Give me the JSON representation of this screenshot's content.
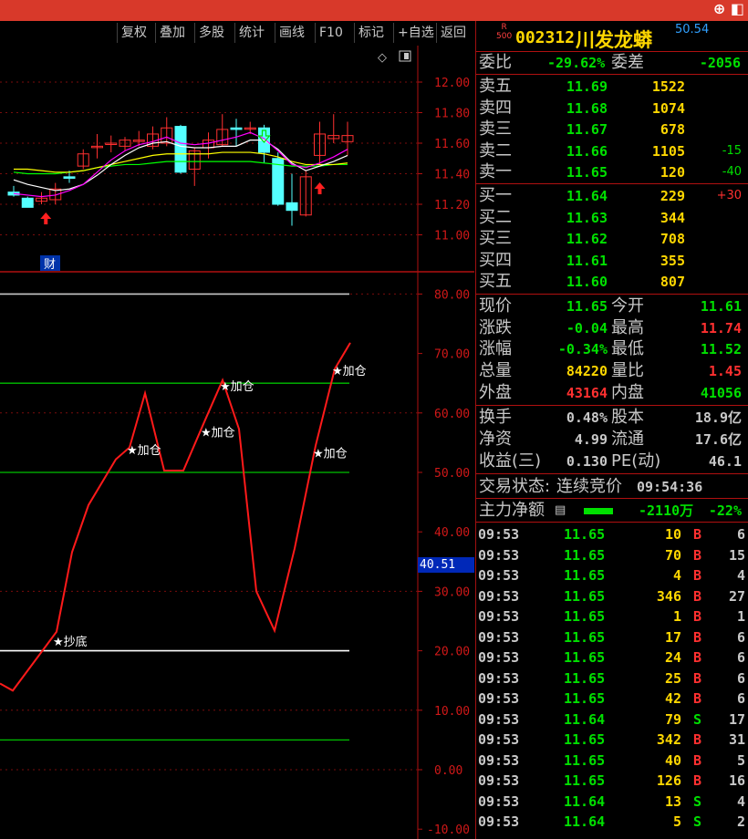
{
  "toolbar": {
    "buttons": [
      "复权",
      "叠加",
      "多股",
      "统计",
      "画线",
      "F10",
      "标记",
      "+自选",
      "返回"
    ]
  },
  "header": {
    "badge_r": "R",
    "badge_num": "500",
    "code": "002312",
    "name": "川发龙蟒",
    "corner_value": "50.54"
  },
  "kline": {
    "y_labels": [
      "12.00",
      "11.80",
      "11.60",
      "11.40",
      "11.20",
      "11.00"
    ],
    "cai_label": "财",
    "colors": {
      "up": "#ff3030",
      "down": "#54ffff",
      "ma5": "#ffffff",
      "ma10": "#ffff00",
      "ma20": "#ff00ff",
      "ma60": "#00ff00"
    }
  },
  "indicator": {
    "y_labels": [
      "80.00",
      "70.00",
      "60.00",
      "50.00",
      "40.00",
      "30.00",
      "20.00",
      "10.00",
      "0.00",
      "-10.00"
    ],
    "price_marker": "40.51",
    "signals": [
      "★抄底",
      "★加仓",
      "★加仓",
      "★加仓",
      "★加仓",
      "★加仓"
    ]
  },
  "order_book": {
    "weibi_label": "委比",
    "weibi": "-29.62%",
    "weicha_label": "委差",
    "weicha": "-2056",
    "asks": [
      {
        "label": "卖五",
        "price": "11.69",
        "vol": "1522",
        "chg": ""
      },
      {
        "label": "卖四",
        "price": "11.68",
        "vol": "1074",
        "chg": ""
      },
      {
        "label": "卖三",
        "price": "11.67",
        "vol": "678",
        "chg": ""
      },
      {
        "label": "卖二",
        "price": "11.66",
        "vol": "1105",
        "chg": "-15"
      },
      {
        "label": "卖一",
        "price": "11.65",
        "vol": "120",
        "chg": "-40"
      }
    ],
    "bids": [
      {
        "label": "买一",
        "price": "11.64",
        "vol": "229",
        "chg": "+30"
      },
      {
        "label": "买二",
        "price": "11.63",
        "vol": "344",
        "chg": ""
      },
      {
        "label": "买三",
        "price": "11.62",
        "vol": "708",
        "chg": ""
      },
      {
        "label": "买四",
        "price": "11.61",
        "vol": "355",
        "chg": ""
      },
      {
        "label": "买五",
        "price": "11.60",
        "vol": "807",
        "chg": ""
      }
    ]
  },
  "quote": [
    {
      "l1": "现价",
      "v1": "11.65",
      "c1": "#00e000",
      "l2": "今开",
      "v2": "11.61",
      "c2": "#00e000"
    },
    {
      "l1": "涨跌",
      "v1": "-0.04",
      "c1": "#00e000",
      "l2": "最高",
      "v2": "11.74",
      "c2": "#ff3030"
    },
    {
      "l1": "涨幅",
      "v1": "-0.34%",
      "c1": "#00e000",
      "l2": "最低",
      "v2": "11.52",
      "c2": "#00e000"
    },
    {
      "l1": "总量",
      "v1": "84220",
      "c1": "#ffd700",
      "l2": "量比",
      "v2": "1.45",
      "c2": "#ff3030"
    },
    {
      "l1": "外盘",
      "v1": "43164",
      "c1": "#ff3030",
      "l2": "内盘",
      "v2": "41056",
      "c2": "#00e000"
    }
  ],
  "fundamentals": [
    {
      "l1": "换手",
      "v1": "0.48%",
      "l2": "股本",
      "v2": "18.9亿"
    },
    {
      "l1": "净资",
      "v1": "4.99",
      "l2": "流通",
      "v2": "17.6亿"
    },
    {
      "l1": "收益(三)",
      "v1": "0.130",
      "l2": "PE(动)",
      "v2": "46.1"
    }
  ],
  "status": {
    "label": "交易状态:",
    "value": "连续竞价",
    "time": "09:54:36"
  },
  "main_flow": {
    "label": "主力净额",
    "amount": "-2110万",
    "pct": "-22%"
  },
  "ticks": [
    {
      "time": "09:53",
      "price": "11.65",
      "vol": "10",
      "bs": "B",
      "n": "6"
    },
    {
      "time": "09:53",
      "price": "11.65",
      "vol": "70",
      "bs": "B",
      "n": "15"
    },
    {
      "time": "09:53",
      "price": "11.65",
      "vol": "4",
      "bs": "B",
      "n": "4"
    },
    {
      "time": "09:53",
      "price": "11.65",
      "vol": "346",
      "bs": "B",
      "n": "27"
    },
    {
      "time": "09:53",
      "price": "11.65",
      "vol": "1",
      "bs": "B",
      "n": "1"
    },
    {
      "time": "09:53",
      "price": "11.65",
      "vol": "17",
      "bs": "B",
      "n": "6"
    },
    {
      "time": "09:53",
      "price": "11.65",
      "vol": "24",
      "bs": "B",
      "n": "6"
    },
    {
      "time": "09:53",
      "price": "11.65",
      "vol": "25",
      "bs": "B",
      "n": "6"
    },
    {
      "time": "09:53",
      "price": "11.65",
      "vol": "42",
      "bs": "B",
      "n": "6"
    },
    {
      "time": "09:53",
      "price": "11.64",
      "vol": "79",
      "bs": "S",
      "n": "17"
    },
    {
      "time": "09:53",
      "price": "11.65",
      "vol": "342",
      "bs": "B",
      "n": "31"
    },
    {
      "time": "09:53",
      "price": "11.65",
      "vol": "40",
      "bs": "B",
      "n": "5"
    },
    {
      "time": "09:53",
      "price": "11.65",
      "vol": "126",
      "bs": "B",
      "n": "16"
    },
    {
      "time": "09:53",
      "price": "11.64",
      "vol": "13",
      "bs": "S",
      "n": "4"
    },
    {
      "time": "09:53",
      "price": "11.64",
      "vol": "5",
      "bs": "S",
      "n": "2"
    }
  ]
}
